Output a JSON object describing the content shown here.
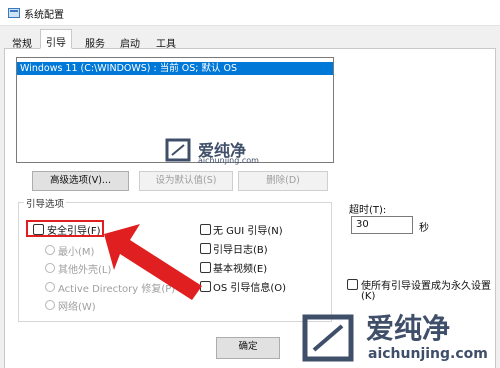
{
  "window": {
    "title": "系统配置"
  },
  "tabs": [
    {
      "label": "常规"
    },
    {
      "label": "引导"
    },
    {
      "label": "服务"
    },
    {
      "label": "启动"
    },
    {
      "label": "工具"
    }
  ],
  "os_list": {
    "entries": [
      "Windows 11 (C:\\WINDOWS) : 当前 OS; 默认 OS"
    ]
  },
  "buttons": {
    "advanced": "高级选项(V)...",
    "set_default": "设为默认值(S)",
    "delete": "删除(D)",
    "ok": "确定"
  },
  "boot_options": {
    "group_label": "引导选项",
    "safe_boot": "安全引导(F)",
    "minimal": "最小(M)",
    "other_shell": "其他外壳(L)",
    "active_directory": "Active Directory 修复(P)",
    "network": "网络(W)",
    "no_gui": "无 GUI 引导(N)",
    "boot_log": "引导日志(B)",
    "base_video": "基本视频(E)",
    "os_info": "OS 引导信息(O)"
  },
  "timeout": {
    "label": "超时(T):",
    "value": "30",
    "unit": "秒"
  },
  "permanent": {
    "label_line1": "使所有引导设置成为永久设置",
    "label_line2": "(K)"
  },
  "watermark": {
    "name": "爱纯净",
    "domain": "aichunjing.com"
  },
  "colors": {
    "selection": "#0078d7",
    "arrow": "#e02020",
    "logo": "#3f4f6a"
  }
}
